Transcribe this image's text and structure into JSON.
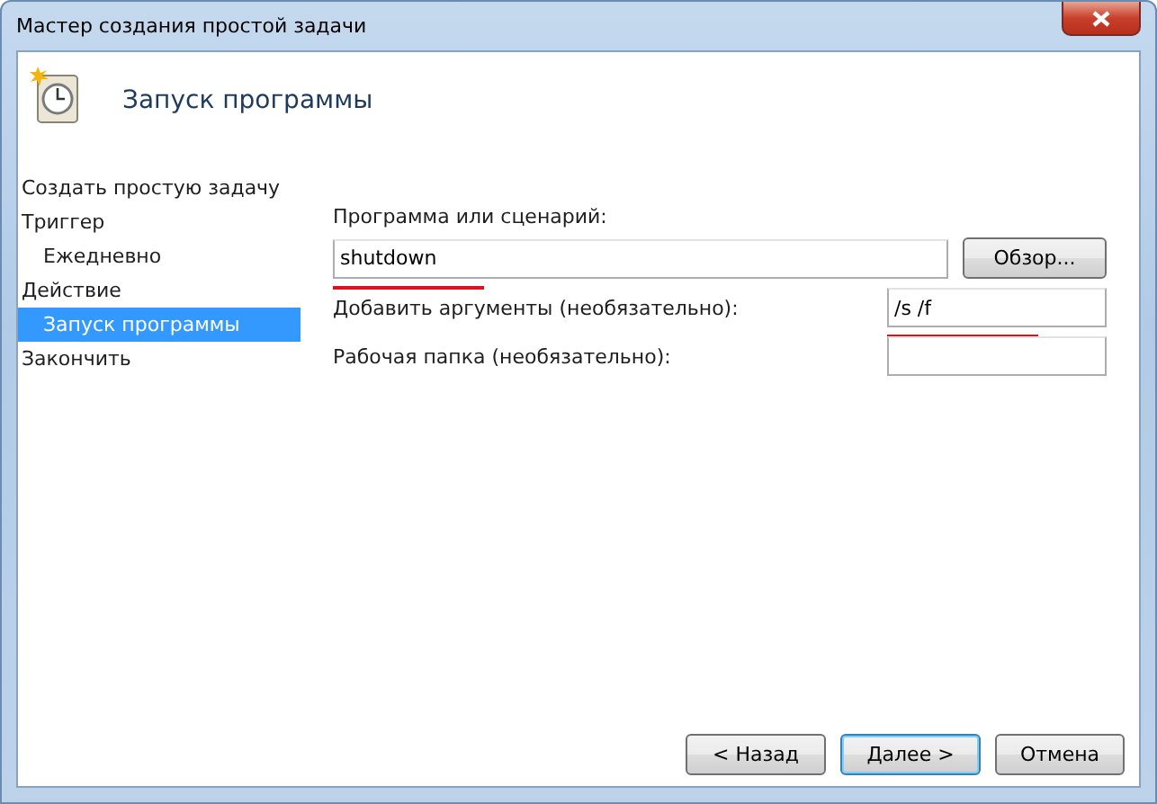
{
  "window": {
    "title": "Мастер создания простой задачи"
  },
  "header": {
    "title": "Запуск программы"
  },
  "steps": [
    {
      "label": "Создать простую задачу",
      "selected": false
    },
    {
      "label": "Триггер",
      "selected": false,
      "children": [
        {
          "label": "Ежедневно",
          "selected": false
        }
      ]
    },
    {
      "label": "Действие",
      "selected": false,
      "children": [
        {
          "label": "Запуск программы",
          "selected": true
        }
      ]
    },
    {
      "label": "Закончить",
      "selected": false
    }
  ],
  "fields": [
    {
      "kind": "stacked",
      "label": "Программа или сценарий:",
      "value": "shutdown",
      "highlighted": true
    },
    {
      "kind": "inline",
      "label": "Добавить аргументы (необязательно):",
      "value": "/s /f",
      "highlighted": true
    },
    {
      "kind": "inline",
      "label": "Рабочая папка (необязательно):",
      "highlighted": false
    }
  ],
  "browse_button": "Обзор...",
  "buttons": [
    {
      "label": "< Назад",
      "default": false
    },
    {
      "label": "Далее >",
      "default": true
    },
    {
      "label": "Отмена",
      "default": false
    }
  ]
}
